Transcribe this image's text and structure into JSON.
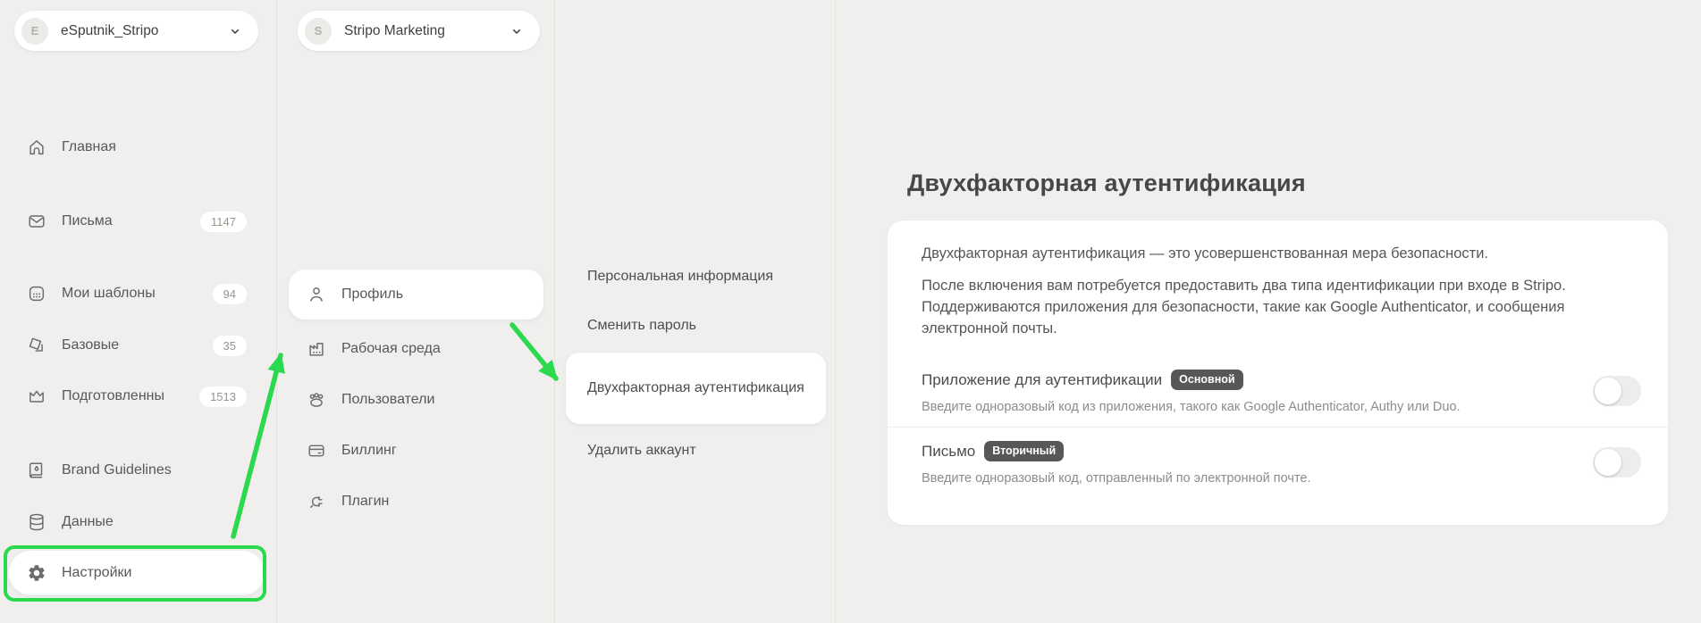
{
  "colors": {
    "annotation_green": "#2bd94f",
    "role_badge_bg": "#575757",
    "page_bg": "#f0efed"
  },
  "account_switcher": {
    "initial": "E",
    "name": "eSputnik_Stripo"
  },
  "project_switcher": {
    "initial": "S",
    "name": "Stripo Marketing"
  },
  "sidebar": {
    "items": [
      {
        "label": "Главная",
        "icon": "home-icon"
      },
      {
        "label": "Письма",
        "icon": "mail-icon",
        "badge": "1147"
      },
      {
        "label": "Мои шаблоны",
        "icon": "templates-icon",
        "badge": "94"
      },
      {
        "label": "Базовые",
        "icon": "basic-templates-icon",
        "badge": "35"
      },
      {
        "label": "Подготовленны",
        "icon": "crown-icon",
        "badge": "1513"
      },
      {
        "label": "Brand Guidelines",
        "icon": "brand-book-icon"
      },
      {
        "label": "Данные",
        "icon": "database-icon"
      },
      {
        "label": "Настройки",
        "icon": "gear-icon",
        "active": true,
        "annotated": "green-box"
      }
    ]
  },
  "settings_nav": {
    "items": [
      {
        "label": "Профиль",
        "icon": "user-icon",
        "active": true
      },
      {
        "label": "Рабочая среда",
        "icon": "workspace-icon"
      },
      {
        "label": "Пользователи",
        "icon": "users-icon"
      },
      {
        "label": "Биллинг",
        "icon": "billing-card-icon"
      },
      {
        "label": "Плагин",
        "icon": "plugin-icon"
      }
    ]
  },
  "profile_nav": {
    "items": [
      {
        "label": "Персональная информация"
      },
      {
        "label": "Сменить пароль"
      },
      {
        "label": "Двухфакторная аутентификация",
        "active": true
      },
      {
        "label": "Удалить аккаунт"
      }
    ]
  },
  "main": {
    "title": "Двухфакторная аутентификация",
    "intro1": "Двухфакторная аутентификация — это усовершенствованная мера безопасности.",
    "intro2": "После включения вам потребуется предоставить два типа идентификации при входе в Stripo. Поддерживаются приложения для безопасности, такие как Google Authenticator, и сообщения электронной почты.",
    "options": [
      {
        "title": "Приложение для аутентификации",
        "badge": "Основной",
        "description": "Введите одноразовый код из приложения, такого как Google Authenticator, Authy или Duo.",
        "enabled": false
      },
      {
        "title": "Письмо",
        "badge": "Вторичный",
        "description": "Введите одноразовый код, отправленный по электронной почте.",
        "enabled": false
      }
    ]
  }
}
